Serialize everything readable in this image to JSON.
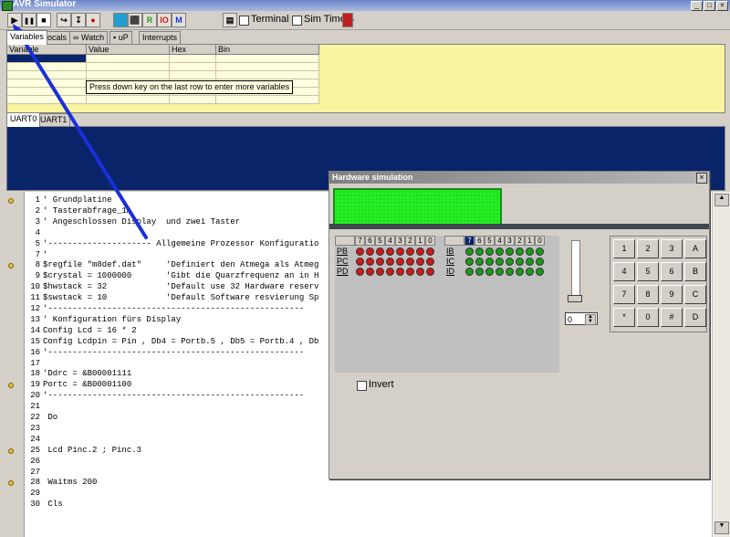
{
  "window": {
    "title": "AVR Simulator"
  },
  "toolbar": {
    "run": "▶",
    "pause": "❚❚",
    "stop": "■",
    "step_btns": [
      "↪",
      "↧",
      "●"
    ],
    "r_label": "R",
    "io_label": "IO",
    "m_label": "M",
    "terminal_label": "Terminal",
    "sim_timers_label": "Sim Timers"
  },
  "var_tabs": [
    "Variables",
    "Locals",
    "Watch",
    "uP",
    "Interrupts"
  ],
  "grid": {
    "headers": [
      "Variable",
      "Value",
      "Hex",
      "Bin"
    ],
    "tooltip": "Press down key on the last row to enter more variables"
  },
  "uart_tabs": [
    "UART0",
    "UART1"
  ],
  "editor": {
    "lines": [
      {
        "n": "1",
        "text": "' Grundplatine"
      },
      {
        "n": "2",
        "text": "' Tasterabfrage_1A"
      },
      {
        "n": "3",
        "text": "' Angeschlossen Display  und zwei Taster"
      },
      {
        "n": "4",
        "text": ""
      },
      {
        "n": "5",
        "text": "'--------------------- Allgemeine Prozessor Konfiguratio"
      },
      {
        "n": "7",
        "text": "'"
      },
      {
        "n": "8",
        "text": "$regfile \"m8def.dat\"     'Definiert den Atmega als Atmeg"
      },
      {
        "n": "9",
        "text": "$crystal = 1000000       'Gibt die Quarzfrequenz an in H"
      },
      {
        "n": "10",
        "text": "$hwstack = 32            'Default use 32 Hardware reserv"
      },
      {
        "n": "11",
        "text": "$swstack = 10            'Default Software resvierung Sp"
      },
      {
        "n": "12",
        "text": "'----------------------------------------------------"
      },
      {
        "n": "13",
        "text": "' Konfiguration fürs Display"
      },
      {
        "n": "14",
        "text": "Config Lcd = 16 * 2"
      },
      {
        "n": "15",
        "text": "Config Lcdpin = Pin , Db4 = Portb.5 , Db5 = Portb.4 , Db"
      },
      {
        "n": "16",
        "text": "'----------------------------------------------------"
      },
      {
        "n": "17",
        "text": ""
      },
      {
        "n": "18",
        "text": "'Ddrc = &B00001111"
      },
      {
        "n": "19",
        "text": "Portc = &B00001100"
      },
      {
        "n": "20",
        "text": "'----------------------------------------------------"
      },
      {
        "n": "21",
        "text": ""
      },
      {
        "n": "22",
        "text": " Do"
      },
      {
        "n": "23",
        "text": ""
      },
      {
        "n": "24",
        "text": ""
      },
      {
        "n": "25",
        "text": " Lcd Pinc.2 ; Pinc.3"
      },
      {
        "n": "26",
        "text": ""
      },
      {
        "n": "27",
        "text": ""
      },
      {
        "n": "28",
        "text": " Waitms 200"
      },
      {
        "n": "29",
        "text": ""
      },
      {
        "n": "30",
        "text": " Cls"
      }
    ]
  },
  "hw": {
    "title": "Hardware simulation",
    "bit_headers": [
      "7",
      "6",
      "5",
      "4",
      "3",
      "2",
      "1",
      "0"
    ],
    "out_ports": [
      "PB",
      "PC",
      "PD"
    ],
    "in_ports": [
      "IB",
      "IC",
      "ID"
    ],
    "spin_value": "0",
    "invert_label": "Invert",
    "keys": [
      "1",
      "2",
      "3",
      "A",
      "4",
      "5",
      "6",
      "B",
      "7",
      "8",
      "9",
      "C",
      "*",
      "0",
      "#",
      "D"
    ]
  },
  "colors": {
    "led_out": "#cc1a1a",
    "led_in": "#1a9a1a",
    "lcd": "#22ee22",
    "uart_bg": "#0a246a",
    "grid_bg": "#f8f4a0"
  }
}
